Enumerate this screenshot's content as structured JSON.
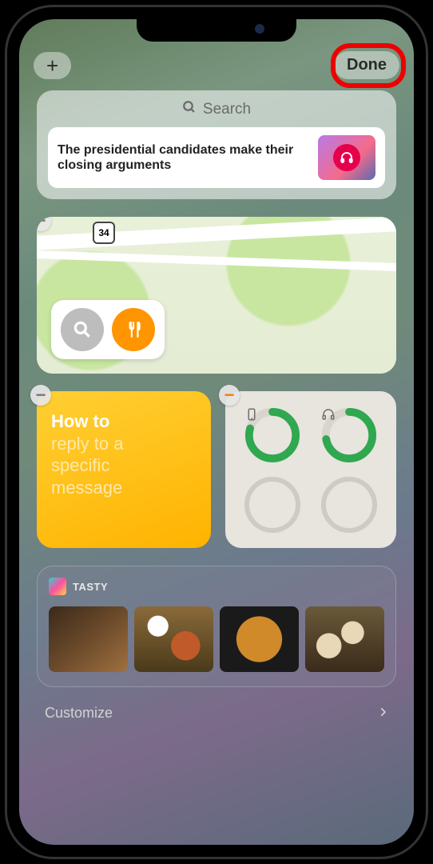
{
  "topbar": {
    "add_label": "+",
    "done_label": "Done"
  },
  "search": {
    "placeholder": "Search"
  },
  "news": {
    "headline": "The presidential candidates make their closing arguments"
  },
  "map": {
    "highway_shield": "34"
  },
  "notes": {
    "line1": "How to",
    "line2": "reply to a",
    "line3": "specific",
    "line4": "message"
  },
  "batteries": {
    "phone_pct": 80,
    "headphones_pct": 72
  },
  "tasty": {
    "app_label": "TASTY"
  },
  "footer": {
    "customize_label": "Customize"
  },
  "colors": {
    "accent_green": "#2fa84f",
    "highlight_red": "#e00000"
  }
}
